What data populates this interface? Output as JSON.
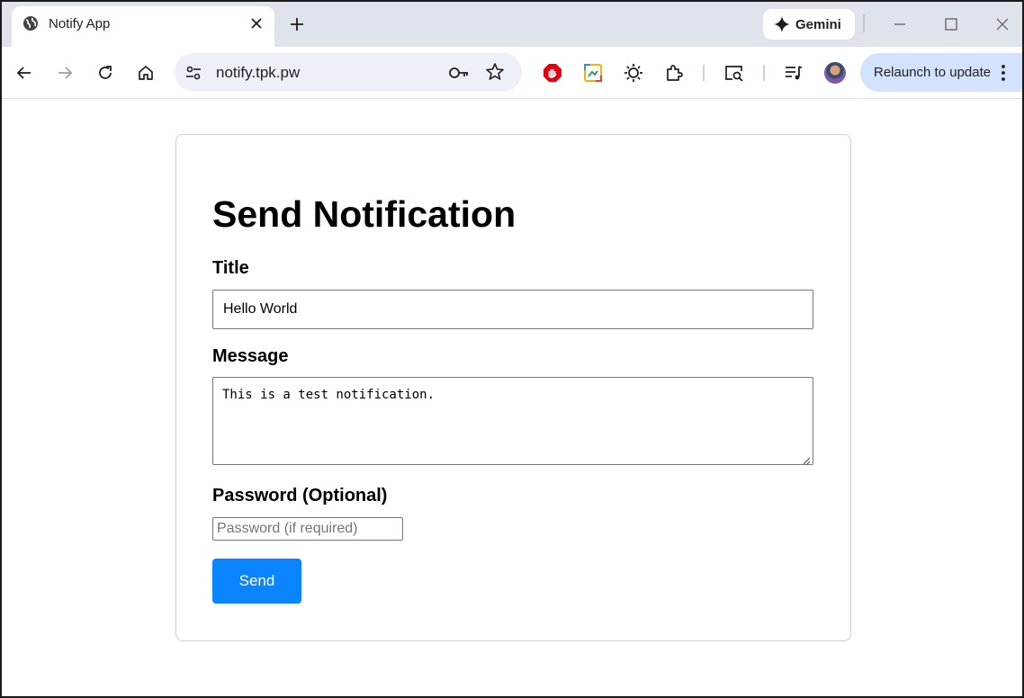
{
  "browser": {
    "tab": {
      "title": "Notify App"
    },
    "gemini_label": "Gemini",
    "address": {
      "url": "notify.tpk.pw"
    },
    "relaunch_label": "Relaunch to update"
  },
  "page": {
    "heading": "Send Notification",
    "title_label": "Title",
    "title_value": "Hello World",
    "message_label": "Message",
    "message_value": "This is a test notification.",
    "password_label": "Password (Optional)",
    "password_placeholder": "Password (if required)",
    "send_label": "Send"
  },
  "colors": {
    "send_button": "#0a84ff",
    "relaunch_pill": "#d3e3fd",
    "tabstrip": "#dfe3eb",
    "omnibox": "#edf0f7"
  }
}
